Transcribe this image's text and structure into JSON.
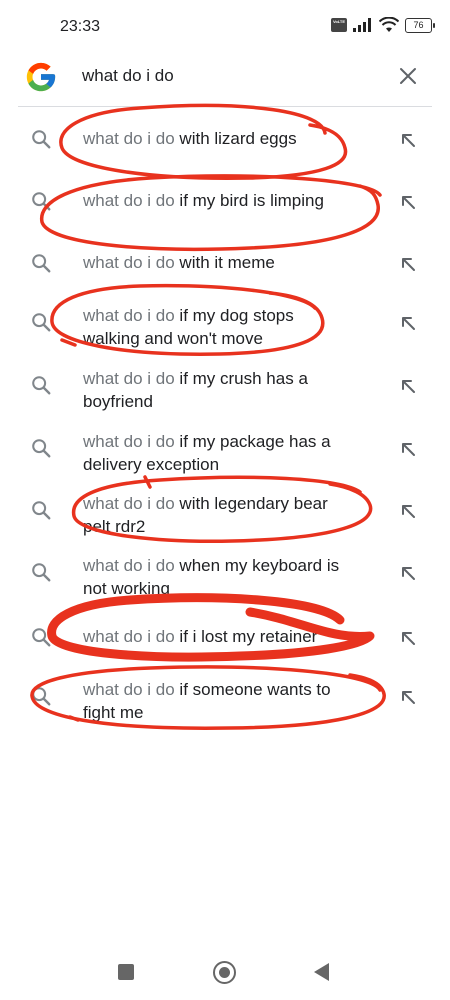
{
  "status_bar": {
    "time": "23:33",
    "network_badge": "VoLTE",
    "battery": "76"
  },
  "search": {
    "query": "what do i do",
    "clear_icon": "close-icon",
    "logo_icon": "google-g-logo"
  },
  "suggestions": [
    {
      "prefix": "what do i do",
      "line1": " with lizard eggs",
      "line2": ""
    },
    {
      "prefix": "what do i do",
      "line1": " if my bird is limping",
      "line2": ""
    },
    {
      "prefix": "what do i do",
      "line1": " with it meme",
      "line2": ""
    },
    {
      "prefix": "what do i do",
      "line1": " if my dog stops",
      "line2": "walking and won't move"
    },
    {
      "prefix": "what do i do",
      "line1": " if my crush has a",
      "line2": "boyfriend"
    },
    {
      "prefix": "what do i do",
      "line1": " if my package has a",
      "line2": "delivery exception"
    },
    {
      "prefix": "what do i do",
      "line1": " with legendary bear",
      "line2": "pelt rdr2"
    },
    {
      "prefix": "what do i do",
      "line1": " when my keyboard is",
      "line2": "not working"
    },
    {
      "prefix": "what do i do",
      "line1": " if i lost my retainer",
      "line2": ""
    },
    {
      "prefix": "what do i do",
      "line1": " if someone wants to",
      "line2": "fight me"
    }
  ],
  "icons": {
    "suggestion_left": "search-icon",
    "suggestion_right": "fill-query-arrow-icon"
  },
  "colors": {
    "annotation_red": "#e8321e",
    "query_prefix_gray": "#70757a",
    "text": "#202124"
  },
  "nav": {
    "recents": "recents-button",
    "home": "home-button",
    "back": "back-button"
  }
}
